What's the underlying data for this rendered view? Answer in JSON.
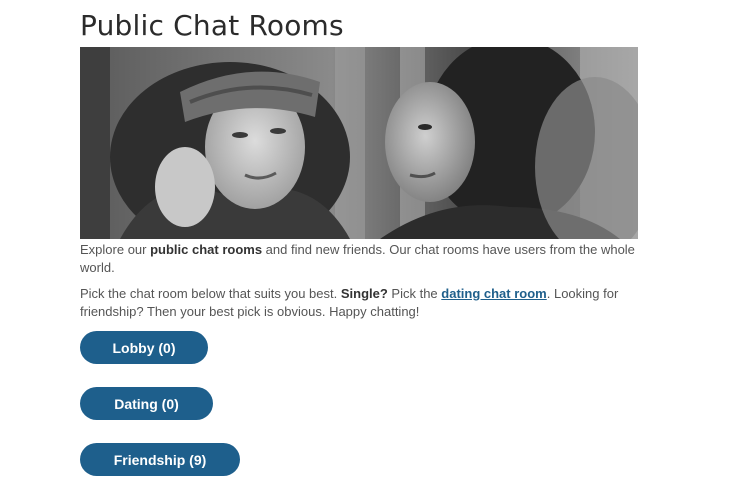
{
  "page": {
    "title": "Public Chat Rooms"
  },
  "intro": {
    "p1_before": "Explore our ",
    "p1_bold": "public chat rooms",
    "p1_after": " and find new friends. Our chat rooms have users from the whole world.",
    "p2_before": "Pick the chat room below that suits you best. ",
    "p2_bold": "Single?",
    "p2_middle": " Pick the ",
    "p2_link": "dating chat room",
    "p2_after": ". Looking for friendship? Then your best pick is obvious. Happy chatting!"
  },
  "rooms": [
    {
      "label": "Lobby (0)"
    },
    {
      "label": "Dating (0)"
    },
    {
      "label": "Friendship (9)"
    }
  ],
  "colors": {
    "button_bg": "#1e5f8c",
    "link": "#1f5f8b"
  }
}
